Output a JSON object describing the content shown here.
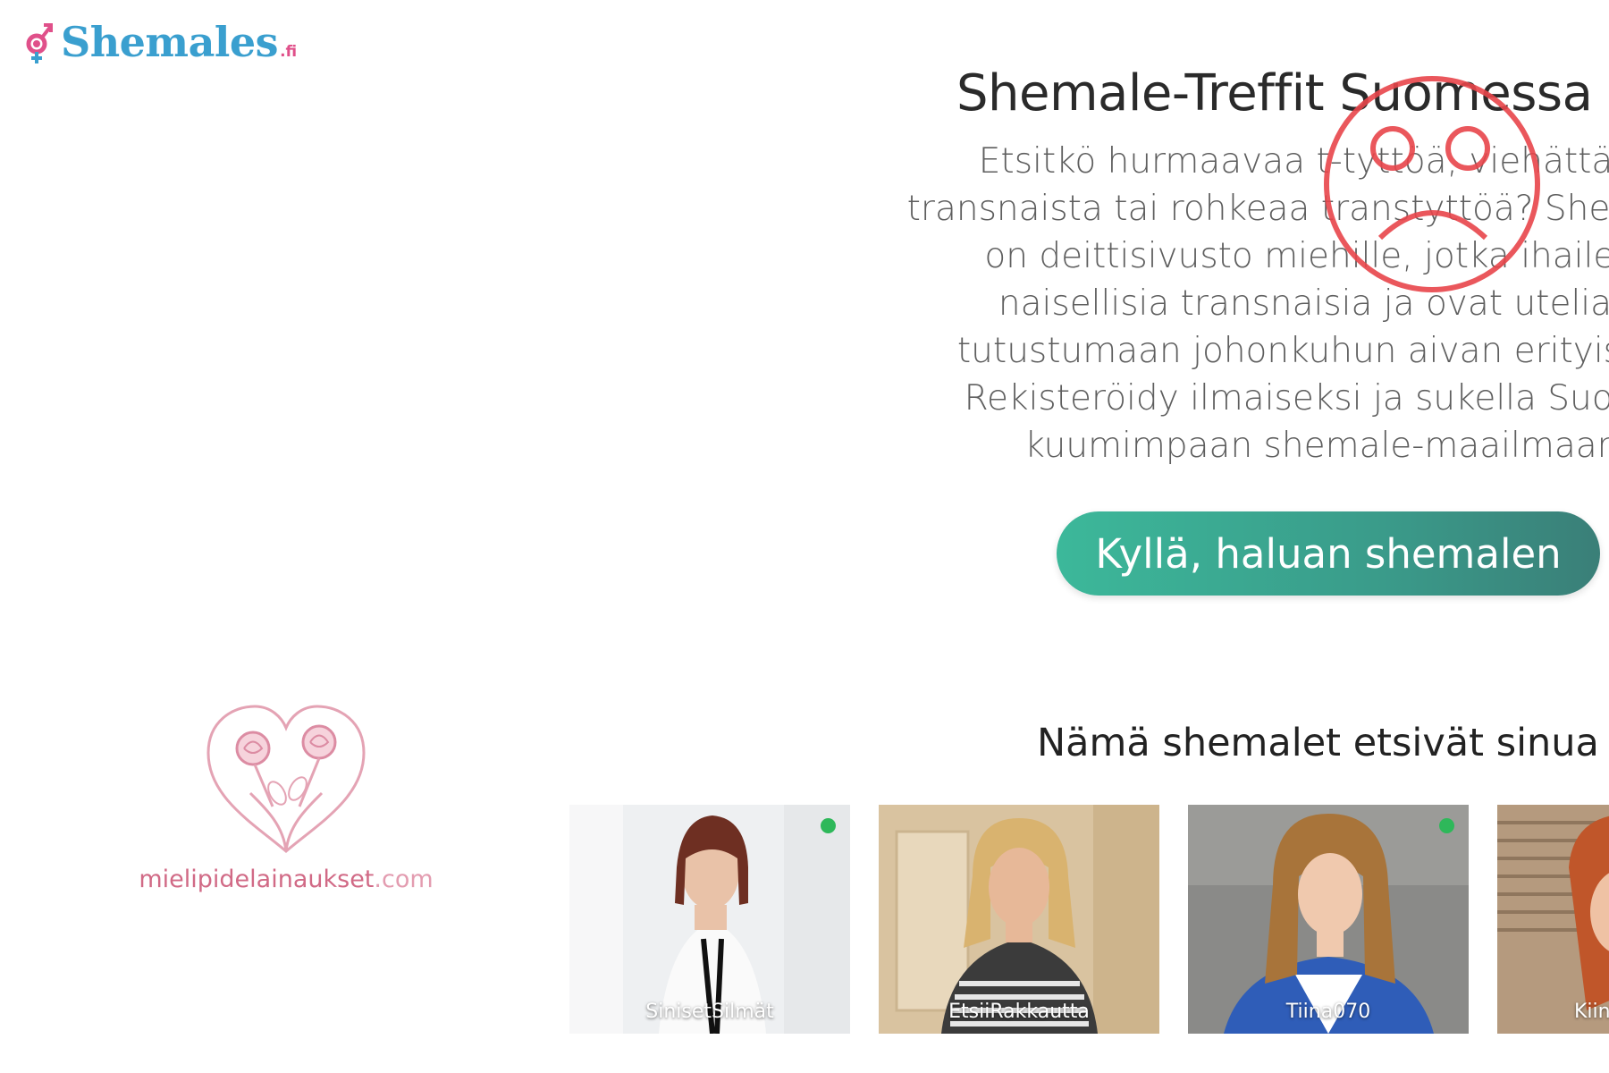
{
  "brand": {
    "name": "Shemales",
    "tld": ".fi"
  },
  "hero": {
    "title": "Shemale-Treffit Suomessa",
    "text": "Etsitkö hurmaavaa t-tyttöä, viehättävää transnaista tai rohkeaa transtyttöä? Shemales.fi on deittisivusto miehille, jotka ihailevat naisellisia transnaisia ja ovat uteliaita tutustumaan johonkuhun aivan erityiseen. Rekisteröidy ilmaiseksi ja sukella Suomen kuumimpaan shemale-maailmaan.",
    "cta_label": "Kyllä, haluan shemalen"
  },
  "profiles_section": {
    "title": "Nämä shemalet etsivät sinua",
    "profiles": [
      {
        "name": "SinisetSilmät",
        "online": true,
        "hair_color": "#6e2f22"
      },
      {
        "name": "EtsiiRakkautta",
        "online": false,
        "hair_color": "#d9b36f"
      },
      {
        "name": "Tiina070",
        "online": true,
        "hair_color": "#a8743a"
      },
      {
        "name": "Kiin",
        "online": false,
        "hair_color": "#c0562a"
      }
    ]
  },
  "watermark": {
    "site": "mielipidelainaukset",
    "suffix": ".com"
  },
  "colors": {
    "brand_blue": "#3a9fcf",
    "brand_pink": "#e0508a",
    "cta_green": "#3cb89a",
    "online_green": "#2eb85a",
    "stamp_red": "#e8454a"
  }
}
